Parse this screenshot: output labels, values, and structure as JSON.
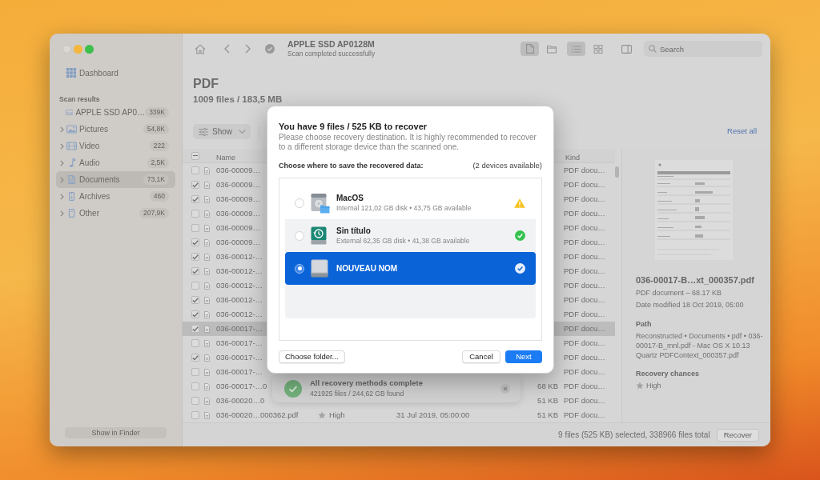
{
  "sidebar": {
    "dashboard": "Dashboard",
    "section_title": "Scan results",
    "items": [
      {
        "label": "APPLE SSD AP0…",
        "count": "339K",
        "kind": "drive",
        "expandable": false,
        "selected": false
      },
      {
        "label": "Pictures",
        "count": "54,8K",
        "kind": "pictures",
        "expandable": true,
        "selected": false
      },
      {
        "label": "Video",
        "count": "222",
        "kind": "video",
        "expandable": true,
        "selected": false
      },
      {
        "label": "Audio",
        "count": "2,5K",
        "kind": "audio",
        "expandable": true,
        "selected": false
      },
      {
        "label": "Documents",
        "count": "73,1K",
        "kind": "documents",
        "expandable": true,
        "selected": true
      },
      {
        "label": "Archives",
        "count": "460",
        "kind": "archives",
        "expandable": true,
        "selected": false
      },
      {
        "label": "Other",
        "count": "207,9K",
        "kind": "other",
        "expandable": true,
        "selected": false
      }
    ],
    "show_in_finder_button": "Show in Finder"
  },
  "toolbar": {
    "title": "APPLE SSD AP0128M",
    "subtitle": "Scan completed successfully",
    "source_modes": [
      {
        "kind": "file",
        "selected": true
      },
      {
        "kind": "folder",
        "selected": false
      }
    ],
    "view_modes": [
      {
        "kind": "list",
        "selected": true
      },
      {
        "kind": "grid",
        "selected": false
      }
    ],
    "search": {
      "placeholder": "Search"
    }
  },
  "header": {
    "title": "PDF",
    "summary": "1009 files / 183,5 MB"
  },
  "filters": {
    "show_button": "Show",
    "reset_link": "Reset all"
  },
  "table": {
    "select_all": {
      "indeterminate": true
    },
    "columns": [
      {
        "kind": "name",
        "label": "Name"
      },
      {
        "kind": "kind",
        "label": "Kind"
      }
    ],
    "rows": [
      {
        "name": "036-00009…",
        "checked": false,
        "selected": false,
        "file_kind": "PDF docu…"
      },
      {
        "name": "036-00009…",
        "checked": true,
        "selected": false,
        "file_kind": "PDF docu…"
      },
      {
        "name": "036-00009…",
        "checked": true,
        "selected": false,
        "file_kind": "PDF docu…"
      },
      {
        "name": "036-00009…",
        "checked": false,
        "selected": false,
        "file_kind": "PDF docu…"
      },
      {
        "name": "036-00009…",
        "checked": false,
        "selected": false,
        "file_kind": "PDF docu…"
      },
      {
        "name": "036-00009…",
        "checked": true,
        "selected": false,
        "file_kind": "PDF docu…"
      },
      {
        "name": "036-00012-…",
        "checked": true,
        "selected": false,
        "file_kind": "PDF docu…"
      },
      {
        "name": "036-00012-…",
        "checked": true,
        "selected": false,
        "file_kind": "PDF docu…"
      },
      {
        "name": "036-00012-…",
        "checked": false,
        "selected": false,
        "file_kind": "PDF docu…"
      },
      {
        "name": "036-00012-…",
        "checked": true,
        "selected": false,
        "file_kind": "PDF docu…"
      },
      {
        "name": "036-00012-…",
        "checked": true,
        "selected": false,
        "file_kind": "PDF docu…"
      },
      {
        "name": "036-00017-…",
        "checked": true,
        "selected": true,
        "file_kind": "PDF docu…"
      },
      {
        "name": "036-00017-…",
        "checked": false,
        "selected": false,
        "file_kind": "PDF docu…"
      },
      {
        "name": "036-00017-…",
        "checked": true,
        "selected": false,
        "file_kind": "PDF docu…"
      },
      {
        "name": "036-00017-…",
        "checked": false,
        "selected": false,
        "file_kind": "PDF docu…"
      },
      {
        "name": "036-00017-…0",
        "checked": false,
        "selected": false,
        "size": "68 KB",
        "file_kind": "PDF docu…"
      },
      {
        "name": "036-00020…0",
        "checked": false,
        "selected": false,
        "size": "51 KB",
        "file_kind": "PDF docu…"
      },
      {
        "name": "036-00020…000362.pdf",
        "checked": false,
        "selected": false,
        "chances": "High",
        "date": "31 Jul 2019, 05:00:00",
        "size": "51 KB",
        "file_kind": "PDF docu…"
      }
    ]
  },
  "toast": {
    "title": "All recovery methods complete",
    "subtitle": "421925 files / 244,62 GB found"
  },
  "details": {
    "file_name": "036-00017-B…xt_000357.pdf",
    "file_info": "PDF document – 68.17 KB",
    "date_modified": "Date modified 18 Oct 2019, 05:00",
    "path_label": "Path",
    "path": "Reconstructed • Documents • pdf • 036-00017-B_mnl.pdf - Mac OS X 10.13 Quartz PDFContext_000357.pdf",
    "chances_label": "Recovery chances",
    "chances": "High"
  },
  "status_bar": {
    "summary": "9 files (525 KB) selected, 338966 files total",
    "recover_button": "Recover"
  },
  "dialog": {
    "title": "You have 9 files / 525 KB to recover",
    "description": "Please choose recovery destination. It is highly recommended to recover to a different storage device than the scanned one.",
    "choose_label": "Choose where to save the recovered data:",
    "devices_count": "(2 devices available)",
    "devices": [
      {
        "name": "MacOS",
        "detail": "Internal 121,02 GB disk • 43,75 GB available",
        "kind": "internal",
        "warning": true,
        "selected": false
      },
      {
        "name": "Sin título",
        "detail": "External 62,35 GB disk • 41,38 GB available",
        "kind": "time-machine",
        "warning": false,
        "selected": false
      },
      {
        "name": "NOUVEAU NOM",
        "kind": "external",
        "warning": false,
        "selected": true
      }
    ],
    "choose_folder_button": "Choose folder...",
    "cancel_button": "Cancel",
    "next_button": "Next"
  }
}
